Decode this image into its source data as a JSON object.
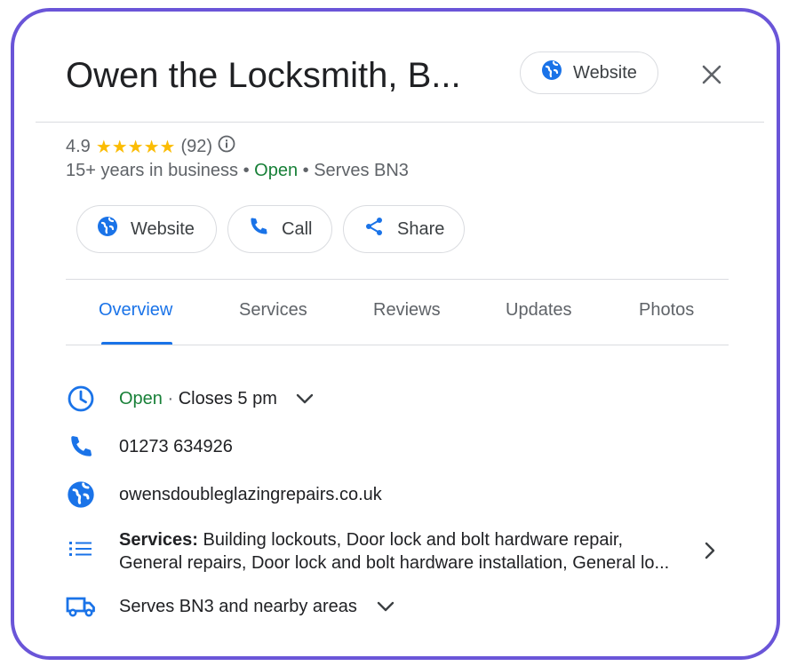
{
  "header": {
    "title": "Owen the Locksmith, B...",
    "website_label": "Website"
  },
  "rating": {
    "score": "4.9",
    "stars": "★★★★★",
    "count": "(92)"
  },
  "meta": {
    "years": "15+ years in business",
    "dot1": " • ",
    "status": "Open",
    "dot2": " • ",
    "serves": "Serves BN3"
  },
  "actions": {
    "website": "Website",
    "call": "Call",
    "share": "Share"
  },
  "tabs": [
    {
      "label": "Overview"
    },
    {
      "label": "Services"
    },
    {
      "label": "Reviews"
    },
    {
      "label": "Updates"
    },
    {
      "label": "Photos"
    }
  ],
  "info": {
    "hours_status": "Open",
    "hours_sep": " · ",
    "hours_close": "Closes 5 pm",
    "phone": "01273 634926",
    "website": "owensdoubleglazingrepairs.co.uk",
    "services_label": "Services:",
    "services_line1": " Building lockouts, Door lock and bolt hardware repair,",
    "services_line2": "General repairs, Door lock and bolt hardware installation, General lo...",
    "area": "Serves BN3 and nearby areas"
  },
  "colors": {
    "accent": "#1a73e8",
    "open": "#188038",
    "star": "#fbbc04",
    "frame": "#6a55d8"
  }
}
